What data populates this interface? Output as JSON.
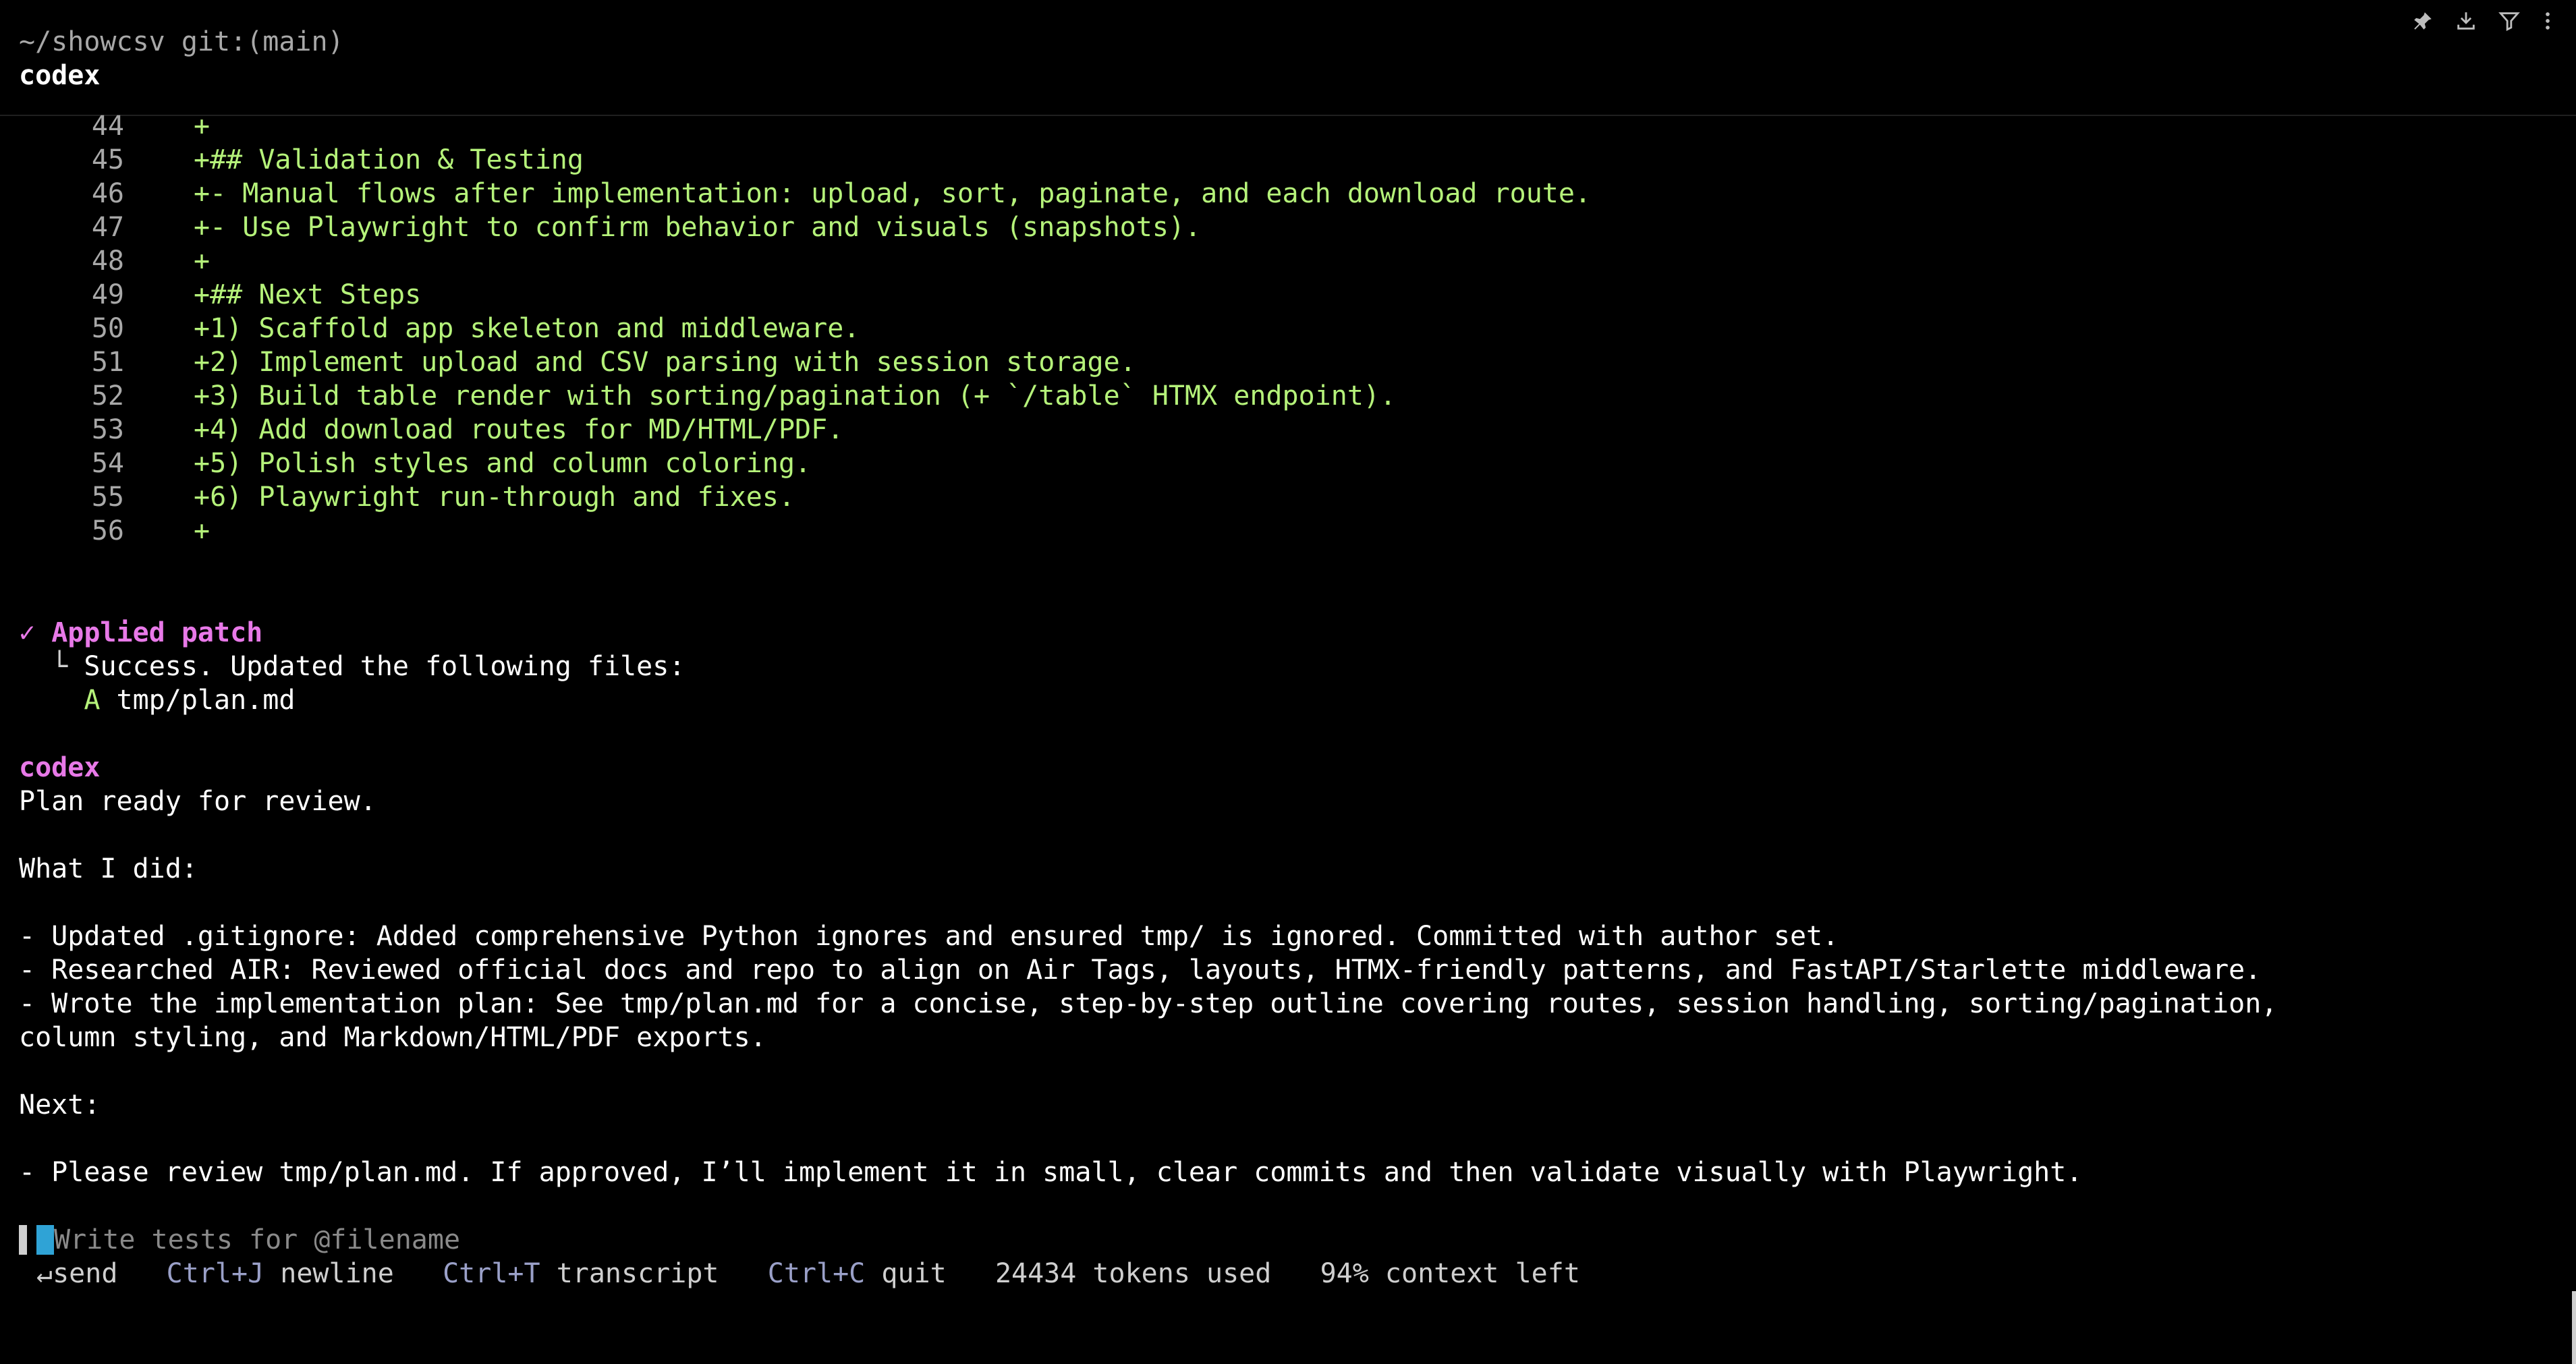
{
  "header": {
    "cwd": "~/showcsv git:(main)",
    "title": "codex"
  },
  "toolbar": {
    "icons": [
      "pin-icon",
      "download-icon",
      "filter-icon",
      "more-icon"
    ]
  },
  "diff": [
    {
      "num": "44",
      "text": "+"
    },
    {
      "num": "45",
      "text": "+## Validation & Testing"
    },
    {
      "num": "46",
      "text": "+- Manual flows after implementation: upload, sort, paginate, and each download route."
    },
    {
      "num": "47",
      "text": "+- Use Playwright to confirm behavior and visuals (snapshots)."
    },
    {
      "num": "48",
      "text": "+"
    },
    {
      "num": "49",
      "text": "+## Next Steps"
    },
    {
      "num": "50",
      "text": "+1) Scaffold app skeleton and middleware."
    },
    {
      "num": "51",
      "text": "+2) Implement upload and CSV parsing with session storage."
    },
    {
      "num": "52",
      "text": "+3) Build table render with sorting/pagination (+ `/table` HTMX endpoint)."
    },
    {
      "num": "53",
      "text": "+4) Add download routes for MD/HTML/PDF."
    },
    {
      "num": "54",
      "text": "+5) Polish styles and column coloring."
    },
    {
      "num": "55",
      "text": "+6) Playwright run-through and fixes."
    },
    {
      "num": "56",
      "text": "+"
    }
  ],
  "patch": {
    "check": "✓",
    "title": "Applied patch",
    "tree": "└",
    "message": "Success. Updated the following files:",
    "file_status": "A",
    "file_path": "tmp/plan.md"
  },
  "response": {
    "speaker": "codex",
    "lines": [
      "Plan ready for review.",
      "",
      "What I did:",
      "",
      "- Updated .gitignore: Added comprehensive Python ignores and ensured tmp/ is ignored. Committed with author set.",
      "- Researched AIR: Reviewed official docs and repo to align on Air Tags, layouts, HTMX-friendly patterns, and FastAPI/Starlette middleware.",
      "- Wrote the implementation plan: See tmp/plan.md for a concise, step-by-step outline covering routes, session handling, sorting/pagination,",
      "column styling, and Markdown/HTML/PDF exports.",
      "",
      "Next:",
      "",
      "- Please review tmp/plan.md. If approved, I’ll implement it in small, clear commits and then validate visually with Playwright."
    ]
  },
  "composer": {
    "placeholder": "Write tests for @filename"
  },
  "hints": {
    "send_key": "↵",
    "send_label": "send",
    "newline_key": "Ctrl+J",
    "newline_label": "newline",
    "transcript_key": "Ctrl+T",
    "transcript_label": "transcript",
    "quit_key": "Ctrl+C",
    "quit_label": "quit",
    "tokens": "24434 tokens used",
    "context": "94% context left"
  },
  "colors": {
    "background": "#000000",
    "diff_added": "#b5f27a",
    "accent_pink": "#e879e8",
    "cursor": "#2fa3d6"
  }
}
